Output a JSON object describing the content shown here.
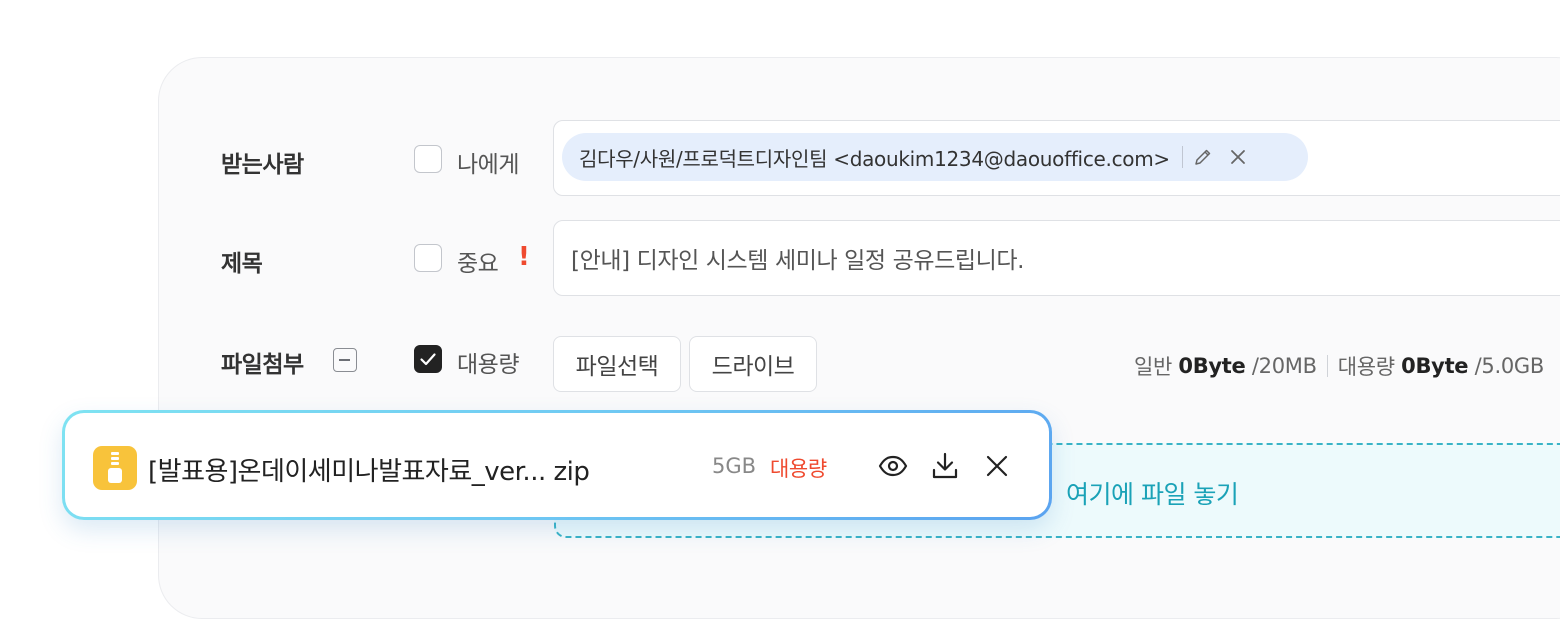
{
  "recipient": {
    "label": "받는사람",
    "to_me_label": "나에게",
    "to_me_checked": false,
    "chip_text": "김다우/사원/프로덕트디자인팀 <daoukim1234@daouoffice.com>"
  },
  "subject": {
    "label": "제목",
    "important_label": "중요",
    "important_checked": false,
    "important_mark": "!",
    "value": "[안내] 디자인 시스템 세미나 일정 공유드립니다."
  },
  "attachment": {
    "label": "파일첨부",
    "large_label": "대용량",
    "large_checked": true,
    "select_button": "파일선택",
    "drive_button": "드라이브",
    "capacity": {
      "normal_label": "일반",
      "normal_used": "0Byte",
      "normal_total": "/20MB",
      "large_label": "대용량",
      "large_used": "0Byte",
      "large_total": "/5.0GB"
    },
    "dropzone_text": "여기에 파일 놓기"
  },
  "file_card": {
    "name": "[발표용]온데이세미나발표자료_ver... zip",
    "size": "5GB",
    "badge": "대용량",
    "icon": "zip-file-icon"
  },
  "colors": {
    "chip_bg": "#e5eefc",
    "accent_red": "#ef4a2f",
    "dropzone_text": "#1aa2b7",
    "zip_icon": "#f8c33b"
  }
}
